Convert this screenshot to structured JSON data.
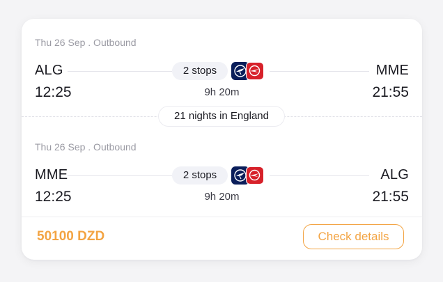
{
  "legs": [
    {
      "date_label": "Thu 26 Sep . Outbound",
      "from_code": "ALG",
      "to_code": "MME",
      "depart_time": "12:25",
      "arrive_time": "21:55",
      "stops_label": "2 stops",
      "duration": "9h 20m",
      "airlines": [
        "lufthansa-logo-icon",
        "air-algerie-logo-icon"
      ]
    },
    {
      "date_label": "Thu 26 Sep . Outbound",
      "from_code": "MME",
      "to_code": "ALG",
      "depart_time": "12:25",
      "arrive_time": "21:55",
      "stops_label": "2 stops",
      "duration": "9h 20m",
      "airlines": [
        "lufthansa-logo-icon",
        "air-algerie-logo-icon"
      ]
    }
  ],
  "stay_label": "21 nights in England",
  "price": "50100 DZD",
  "check_details_label": "Check details",
  "colors": {
    "accent": "#f3a443",
    "lufthansa_blue": "#0a1e5a",
    "air_algerie_red": "#d7212a"
  }
}
